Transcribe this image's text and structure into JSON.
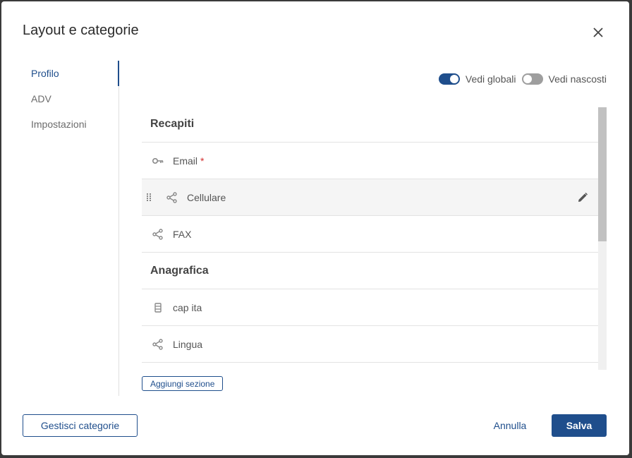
{
  "dialog": {
    "title": "Layout e categorie",
    "close_icon": "close-icon"
  },
  "nav": {
    "items": [
      {
        "label": "Profilo",
        "active": true
      },
      {
        "label": "ADV",
        "active": false
      },
      {
        "label": "Impostazioni",
        "active": false
      }
    ]
  },
  "toggles": {
    "globals_label": "Vedi globali",
    "globals_on": true,
    "hidden_label": "Vedi nascosti",
    "hidden_on": false
  },
  "list": {
    "section1": "Recapiti",
    "email": {
      "label": "Email",
      "icon": "key-icon",
      "required_mark": "*"
    },
    "cellulare": {
      "label": "Cellulare",
      "icon": "share-icon"
    },
    "fax": {
      "label": "FAX",
      "icon": "share-icon"
    },
    "section2": "Anagrafica",
    "cap": {
      "label": "cap ita",
      "icon": "document-icon"
    },
    "lingua": {
      "label": "Lingua",
      "icon": "share-icon"
    }
  },
  "actions": {
    "add_section": "Aggiungi sezione",
    "manage_categories": "Gestisci categorie",
    "cancel": "Annulla",
    "save": "Salva"
  },
  "colors": {
    "accent": "#1f4e8c",
    "required": "#d32f2f"
  }
}
